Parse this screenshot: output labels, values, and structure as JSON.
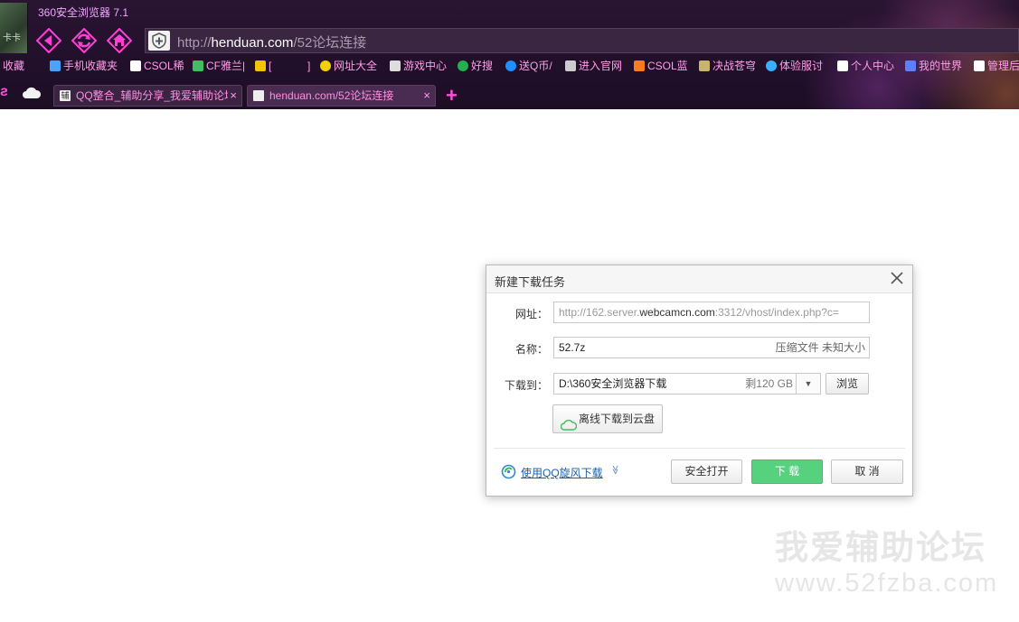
{
  "browser": {
    "app_title": "360安全浏览器 7.1",
    "address": {
      "scheme": "http://",
      "host": "henduan.com",
      "path": "/52论坛连接"
    },
    "bookmarks": [
      {
        "label": "收藏",
        "icon": "folder-icon",
        "color": "#ff9ee8"
      },
      {
        "label": "手机收藏夹",
        "icon": "phone-icon",
        "color": "#4aa3ff"
      },
      {
        "label": "CSOL稀",
        "icon": "page-icon",
        "color": "#ffffff"
      },
      {
        "label": "CF雅兰|",
        "icon": "tree-icon",
        "color": "#3fbf5f"
      },
      {
        "label": "[",
        "icon": "pai-icon",
        "color": "#f3c200"
      },
      {
        "label": "]",
        "icon": "",
        "color": ""
      },
      {
        "label": "网址大全",
        "icon": "plus-icon",
        "color": "#f3d000"
      },
      {
        "label": "游戏中心",
        "icon": "gamepad-icon",
        "color": "#dddddd"
      },
      {
        "label": "好搜",
        "icon": "search-icon",
        "color": "#23b04f"
      },
      {
        "label": "送Q币/",
        "icon": "info-icon",
        "color": "#1e8fff"
      },
      {
        "label": "进入官网",
        "icon": "glasses-icon",
        "color": "#cccccc"
      },
      {
        "label": "CSOL蓝",
        "icon": "csol-icon",
        "color": "#ff7a1a"
      },
      {
        "label": "决战苍穹",
        "icon": "game-icon",
        "color": "#c9b56a"
      },
      {
        "label": "体验服讨",
        "icon": "chrome-icon",
        "color": "#38b0ff"
      },
      {
        "label": "个人中心",
        "icon": "page-icon",
        "color": "#ffffff"
      },
      {
        "label": "我的世界",
        "icon": "bear-icon",
        "color": "#5b7fff"
      },
      {
        "label": "管理后",
        "icon": "page-icon",
        "color": "#ffffff"
      }
    ],
    "tabs": [
      {
        "label": "QQ整合_辅助分享_我爱辅助论坛",
        "favicon_text": "辅",
        "close": "×"
      },
      {
        "label": "henduan.com/52论坛连接",
        "favicon_text": "",
        "close": "×"
      }
    ],
    "new_tab": "+"
  },
  "dialog": {
    "title": "新建下载任务",
    "url_label": "网址：",
    "url_value_pre": "http://162.server.",
    "url_value_host": "webcamcn.com",
    "url_value_post": ":3312/vhost/index.php?c=",
    "name_label": "名称：",
    "name_value": "52.7z",
    "name_meta": "压缩文件 未知大小",
    "dest_label": "下载到：",
    "dest_value": "D:\\360安全浏览器下载",
    "dest_free": "剩120 GB",
    "dest_drop": "▼",
    "browse_label": "浏览",
    "cloud_label": "离线下载到云盘",
    "qq_link": "使用QQ旋风下载",
    "qq_chevron": "≫",
    "open_label": "安全打开",
    "download_label": "下 载",
    "cancel_label": "取 消"
  },
  "watermark": {
    "cn": "我爱辅助论坛",
    "en": "www.52fzba.com"
  },
  "colors": {
    "chrome_bg": "#22102b",
    "accent_pink": "#ff4fd8",
    "download_green": "#56d27e",
    "link_blue": "#1a5ea6"
  }
}
